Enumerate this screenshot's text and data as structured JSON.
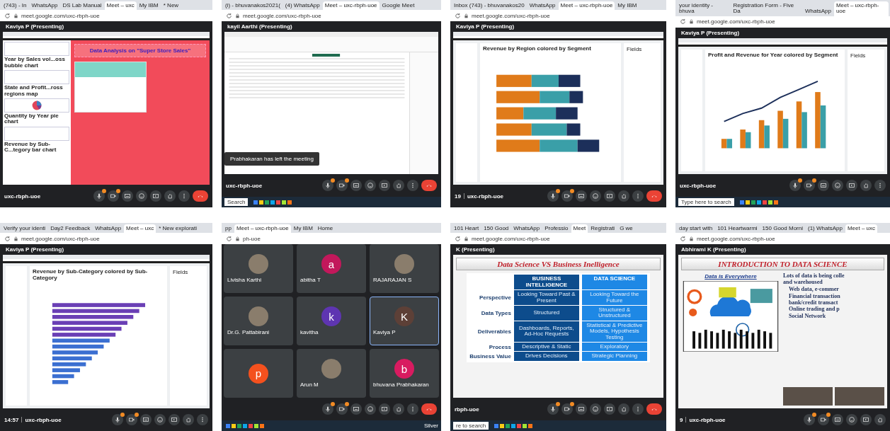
{
  "panels": [
    {
      "tabs": [
        {
          "label": "(743) - In",
          "selected": false
        },
        {
          "label": "WhatsApp",
          "selected": false
        },
        {
          "label": "DS Lab Manual",
          "selected": false
        },
        {
          "label": "Meet – uxc",
          "selected": true
        },
        {
          "label": "My IBM",
          "selected": false
        },
        {
          "label": "* New",
          "selected": false
        }
      ],
      "url": "meet.google.com/uxc-rbph-uoe",
      "presenter": "Kaviya P (Presenting)",
      "content": {
        "kind": "dashboard",
        "canvas_title": "Data Analysis on \"Super Store Sales\"",
        "visualizations": [
          "Year by Sales vol...oss bubble chart",
          "State and Profit...ross regions map",
          "Quantity by Year pie chart",
          "Revenue by Sub-C...tegory bar chart"
        ]
      },
      "meeting_code": "uxc-rbph-uoe",
      "controls": [
        {
          "kind": "mic",
          "badge": true
        },
        {
          "kind": "camera",
          "badge": true
        },
        {
          "kind": "captions",
          "badge": false
        },
        {
          "kind": "emoji",
          "badge": false
        },
        {
          "kind": "present",
          "badge": false
        },
        {
          "kind": "hand",
          "badge": false
        },
        {
          "kind": "more",
          "badge": false
        },
        {
          "kind": "end",
          "badge": false
        }
      ]
    },
    {
      "tabs": [
        {
          "label": "(i) - bhuvanakos2021(",
          "selected": false
        },
        {
          "label": "(4) WhatsApp",
          "selected": false
        },
        {
          "label": "Meet – uxc-rbph-uoe",
          "selected": true
        },
        {
          "label": "Google Meet",
          "selected": false
        }
      ],
      "url": "meet.google.com/uxc-rbph-uoe",
      "presenter": "kayil Aarthi (Presenting)",
      "content": {
        "kind": "spreadsheet",
        "toast": "Prabhakaran has left the meeting"
      },
      "meeting_code": "uxc-rbph-uoe",
      "controls": [
        {
          "kind": "mic",
          "badge": true
        },
        {
          "kind": "camera",
          "badge": true
        },
        {
          "kind": "captions",
          "badge": false
        },
        {
          "kind": "emoji",
          "badge": false
        },
        {
          "kind": "present",
          "badge": false
        },
        {
          "kind": "hand",
          "badge": false
        },
        {
          "kind": "more",
          "badge": false
        },
        {
          "kind": "end",
          "badge": false
        }
      ],
      "taskbar": {
        "search": "Search"
      }
    },
    {
      "tabs": [
        {
          "label": "Inbox (743) - bhuvanakos20",
          "selected": false
        },
        {
          "label": "WhatsApp",
          "selected": false
        },
        {
          "label": "Meet – uxc-rbph-uoe",
          "selected": true
        },
        {
          "label": "My IBM",
          "selected": false
        }
      ],
      "url": "meet.google.com/uxc-rbph-uoe",
      "presenter": "Kaviya P (Presenting)",
      "content": {
        "kind": "stacked_bar_chart",
        "chart_title": "Revenue by Region colored by Segment",
        "fields_label": "Fields"
      },
      "clock": "19",
      "meeting_code": "uxc-rbph-uoe",
      "controls": [
        {
          "kind": "mic",
          "badge": true
        },
        {
          "kind": "camera",
          "badge": true
        },
        {
          "kind": "captions",
          "badge": false
        },
        {
          "kind": "emoji",
          "badge": false
        },
        {
          "kind": "present",
          "badge": false
        },
        {
          "kind": "hand",
          "badge": false
        },
        {
          "kind": "more",
          "badge": false
        },
        {
          "kind": "end",
          "badge": false
        }
      ]
    },
    {
      "tabs": [
        {
          "label": "your identity - bhuva",
          "selected": false
        },
        {
          "label": "Registration Form - Five Da",
          "selected": false
        },
        {
          "label": "WhatsApp",
          "selected": false
        },
        {
          "label": "Meet – uxc-rbph-uoe",
          "selected": true
        }
      ],
      "url": "meet.google.com/uxc-rbph-uoe",
      "presenter": "Kaviya P (Presenting)",
      "content": {
        "kind": "combo_chart",
        "chart_title": "Profit and Revenue for Year colored by Segment",
        "fields_label": "Fields"
      },
      "meeting_code": "uxc-rbph-uoe",
      "controls": [
        {
          "kind": "mic",
          "badge": true
        },
        {
          "kind": "camera",
          "badge": true
        },
        {
          "kind": "captions",
          "badge": false
        },
        {
          "kind": "emoji",
          "badge": false
        },
        {
          "kind": "present",
          "badge": false
        },
        {
          "kind": "hand",
          "badge": false
        },
        {
          "kind": "more",
          "badge": false
        }
      ],
      "taskbar": {
        "search": "Type here to search"
      }
    },
    {
      "tabs": [
        {
          "label": "Verify your identi",
          "selected": false
        },
        {
          "label": "Day2 Feedback",
          "selected": false
        },
        {
          "label": "WhatsApp",
          "selected": false
        },
        {
          "label": "Meet – uxc",
          "selected": true
        },
        {
          "label": "* New explorati",
          "selected": false
        }
      ],
      "url": "meet.google.com/uxc-rbph-uoe",
      "presenter": "Kaviya P (Presenting)",
      "content": {
        "kind": "ranked_bar_chart",
        "chart_title": "Revenue by Sub-Category colored by Sub-Category",
        "fields_label": "Fields"
      },
      "clock": "14:57",
      "meeting_code": "uxc-rbph-uoe",
      "controls": [
        {
          "kind": "mic",
          "badge": true
        },
        {
          "kind": "camera",
          "badge": true
        },
        {
          "kind": "captions",
          "badge": false
        },
        {
          "kind": "emoji",
          "badge": false
        },
        {
          "kind": "present",
          "badge": false
        },
        {
          "kind": "hand",
          "badge": false
        },
        {
          "kind": "more",
          "badge": false
        }
      ]
    },
    {
      "tabs": [
        {
          "label": "pp",
          "selected": false
        },
        {
          "label": "Meet – uxc-rbph-uoe",
          "selected": true
        },
        {
          "label": "My IBM",
          "selected": false
        },
        {
          "label": "Home",
          "selected": false
        }
      ],
      "url": "ph-uoe",
      "content": {
        "kind": "participants",
        "tiles": [
          {
            "name": "Livisha Karthi",
            "kind": "photo",
            "speaking": false
          },
          {
            "name": "abitha T",
            "kind": "letter",
            "letter": "a",
            "color": "#c2185b",
            "speaking": false
          },
          {
            "name": "RAJARAJAN S",
            "kind": "photo",
            "speaking": false
          },
          {
            "name": "Dr.G. Pattabirani",
            "kind": "photo",
            "speaking": false
          },
          {
            "name": "kavitha",
            "kind": "letter",
            "letter": "k",
            "color": "#5e35b1",
            "speaking": false
          },
          {
            "name": "Kaviya P",
            "kind": "letter",
            "letter": "K",
            "color": "#5d4037",
            "speaking": true
          },
          {
            "kind": "letter",
            "letter": "p",
            "color": "#f4511e",
            "speaking": false
          },
          {
            "name": "Arun M",
            "kind": "photo",
            "speaking": false
          },
          {
            "name": "bhuvana Prabhakaran",
            "kind": "letter",
            "letter": "b",
            "color": "#d81b60",
            "speaking": false
          }
        ]
      },
      "controls": [
        {
          "kind": "mic",
          "badge": true
        },
        {
          "kind": "camera",
          "badge": true
        },
        {
          "kind": "captions",
          "badge": false
        },
        {
          "kind": "emoji",
          "badge": false
        },
        {
          "kind": "present",
          "badge": false
        },
        {
          "kind": "hand",
          "badge": false
        },
        {
          "kind": "more",
          "badge": false
        },
        {
          "kind": "end",
          "badge": false
        }
      ],
      "taskbar": {
        "weather": "Silver"
      }
    },
    {
      "tabs": [
        {
          "label": "101 Heart",
          "selected": false
        },
        {
          "label": "150 Good",
          "selected": false
        },
        {
          "label": "WhatsApp",
          "selected": false
        },
        {
          "label": "Professio",
          "selected": false
        },
        {
          "label": "Meet",
          "selected": true
        },
        {
          "label": "Registrati",
          "selected": false
        },
        {
          "label": "G we",
          "selected": false
        }
      ],
      "url": "meet.google.com/uxc-rbph-uoe",
      "presenter": "K (Presenting)",
      "content": {
        "kind": "compare_slide",
        "title": "Data Science VS Business Inelligence",
        "columns": [
          "BUSINESS INTELLIGENCE",
          "DATA SCIENCE"
        ],
        "rows": [
          {
            "label": "Perspective",
            "cells": [
              "Looking Toward Past & Present",
              "Looking Toward the Future"
            ]
          },
          {
            "label": "Data Types",
            "cells": [
              "Structured",
              "Structured & Unstructured"
            ]
          },
          {
            "label": "Deliverables",
            "cells": [
              "Dashboards, Reports, Ad-Hoc Requests",
              "Statistical & Predictive Models, Hypothesis Testing"
            ]
          },
          {
            "label": "Process",
            "cells": [
              "Descriptive & Static",
              "Exploratory"
            ]
          },
          {
            "label": "Business Value",
            "cells": [
              "Drives Decisions",
              "Strategic Planning"
            ]
          }
        ]
      },
      "meeting_code": "rbph-uoe",
      "controls": [
        {
          "kind": "mic",
          "badge": true
        },
        {
          "kind": "camera",
          "badge": true
        },
        {
          "kind": "captions",
          "badge": false
        },
        {
          "kind": "emoji",
          "badge": false
        },
        {
          "kind": "present",
          "badge": false
        },
        {
          "kind": "hand",
          "badge": false
        },
        {
          "kind": "more",
          "badge": false
        },
        {
          "kind": "end",
          "badge": false
        }
      ],
      "taskbar": {
        "search": "re to search"
      }
    },
    {
      "tabs": [
        {
          "label": "day start with",
          "selected": false
        },
        {
          "label": "101 Heartwarmi",
          "selected": false
        },
        {
          "label": "150 Good Morni",
          "selected": false
        },
        {
          "label": "(1) WhatsApp",
          "selected": false
        },
        {
          "label": "Meet – uxc",
          "selected": true
        }
      ],
      "url": "meet.google.com/uxc-rbph-uoe",
      "presenter": "Abhirami K (Presenting)",
      "content": {
        "kind": "intro_slide",
        "title": "INTRODUCTION TO DATA SCIENCE",
        "subtitle": "Data is Everywhere",
        "bullets": [
          {
            "lines": [
              "Lots of data is being colle",
              "and warehoused"
            ],
            "children": [
              {
                "lines": [
                  "Web data, e-commer"
                ]
              },
              {
                "lines": [
                  "Financial transaction",
                  "bank/credit transact"
                ]
              },
              {
                "lines": [
                  "Online trading and p"
                ]
              },
              {
                "lines": [
                  "Social Network"
                ]
              }
            ]
          }
        ]
      },
      "clock": "9",
      "meeting_code": "uxc-rbph-uoe",
      "controls": [
        {
          "kind": "mic",
          "badge": true
        },
        {
          "kind": "camera",
          "badge": true
        },
        {
          "kind": "captions",
          "badge": false
        },
        {
          "kind": "emoji",
          "badge": false
        },
        {
          "kind": "present",
          "badge": false
        },
        {
          "kind": "hand",
          "badge": false
        }
      ]
    }
  ]
}
